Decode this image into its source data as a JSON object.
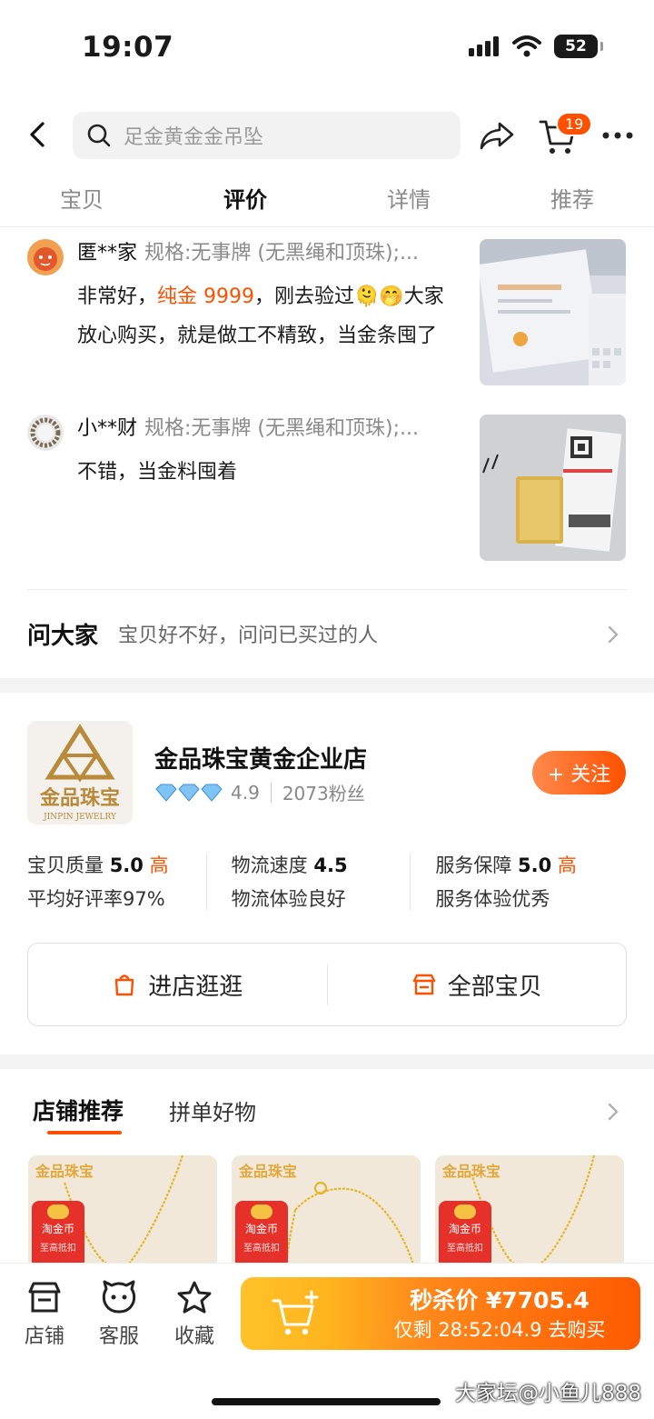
{
  "status": {
    "time": "19:07",
    "battery": "52"
  },
  "nav": {
    "search_placeholder": "足金黄金金吊坠",
    "cart_count": "19"
  },
  "tabs": [
    "宝贝",
    "评价",
    "详情",
    "推荐"
  ],
  "reviews": [
    {
      "name": "匿**家",
      "spec": "规格:无事牌 (无黑绳和顶珠);...",
      "body_pre": "非常好，",
      "body_highlight": "纯金 9999",
      "body_post": "，刚去验过🫠🤭大家放心购买，就是做工不精致，当金条囤了"
    },
    {
      "name": "小**财",
      "spec": "规格:无事牌 (无黑绳和顶珠);...",
      "body": "不错，当金料囤着"
    }
  ],
  "ask": {
    "title": "问大家",
    "subtitle": "宝贝好不好，问问已买过的人"
  },
  "shop": {
    "logo_text": "金品珠宝",
    "logo_sub": "JINPIN JEWELRY",
    "name": "金品珠宝黄金企业店",
    "rating": "4.9",
    "fans": "2073粉丝",
    "follow_label": "+ 关注",
    "scores": [
      {
        "label": "宝贝质量",
        "value": "5.0",
        "level": "高",
        "desc": "平均好评率97%"
      },
      {
        "label": "物流速度",
        "value": "4.5",
        "level": "",
        "desc": "物流体验良好"
      },
      {
        "label": "服务保障",
        "value": "5.0",
        "level": "高",
        "desc": "服务体验优秀"
      }
    ],
    "enter_label": "进店逛逛",
    "all_items_label": "全部宝贝"
  },
  "recommend": {
    "tabs": [
      "店铺推荐",
      "拼单好物"
    ],
    "card_brand": "金品珠宝",
    "card_badge_title": "淘金币",
    "card_badge_sub": "至高抵扣"
  },
  "bottom": {
    "shop_label": "店铺",
    "service_label": "客服",
    "favorite_label": "收藏",
    "price_line": "秒杀价 ¥7705.4",
    "countdown_line": "仅剩 28:52:04.9 去购买"
  },
  "watermark": "大家坛@小鱼儿888",
  "colors": {
    "accent": "#ff5000",
    "buy_start": "#ffc22a",
    "buy_end": "#ff5a00"
  }
}
